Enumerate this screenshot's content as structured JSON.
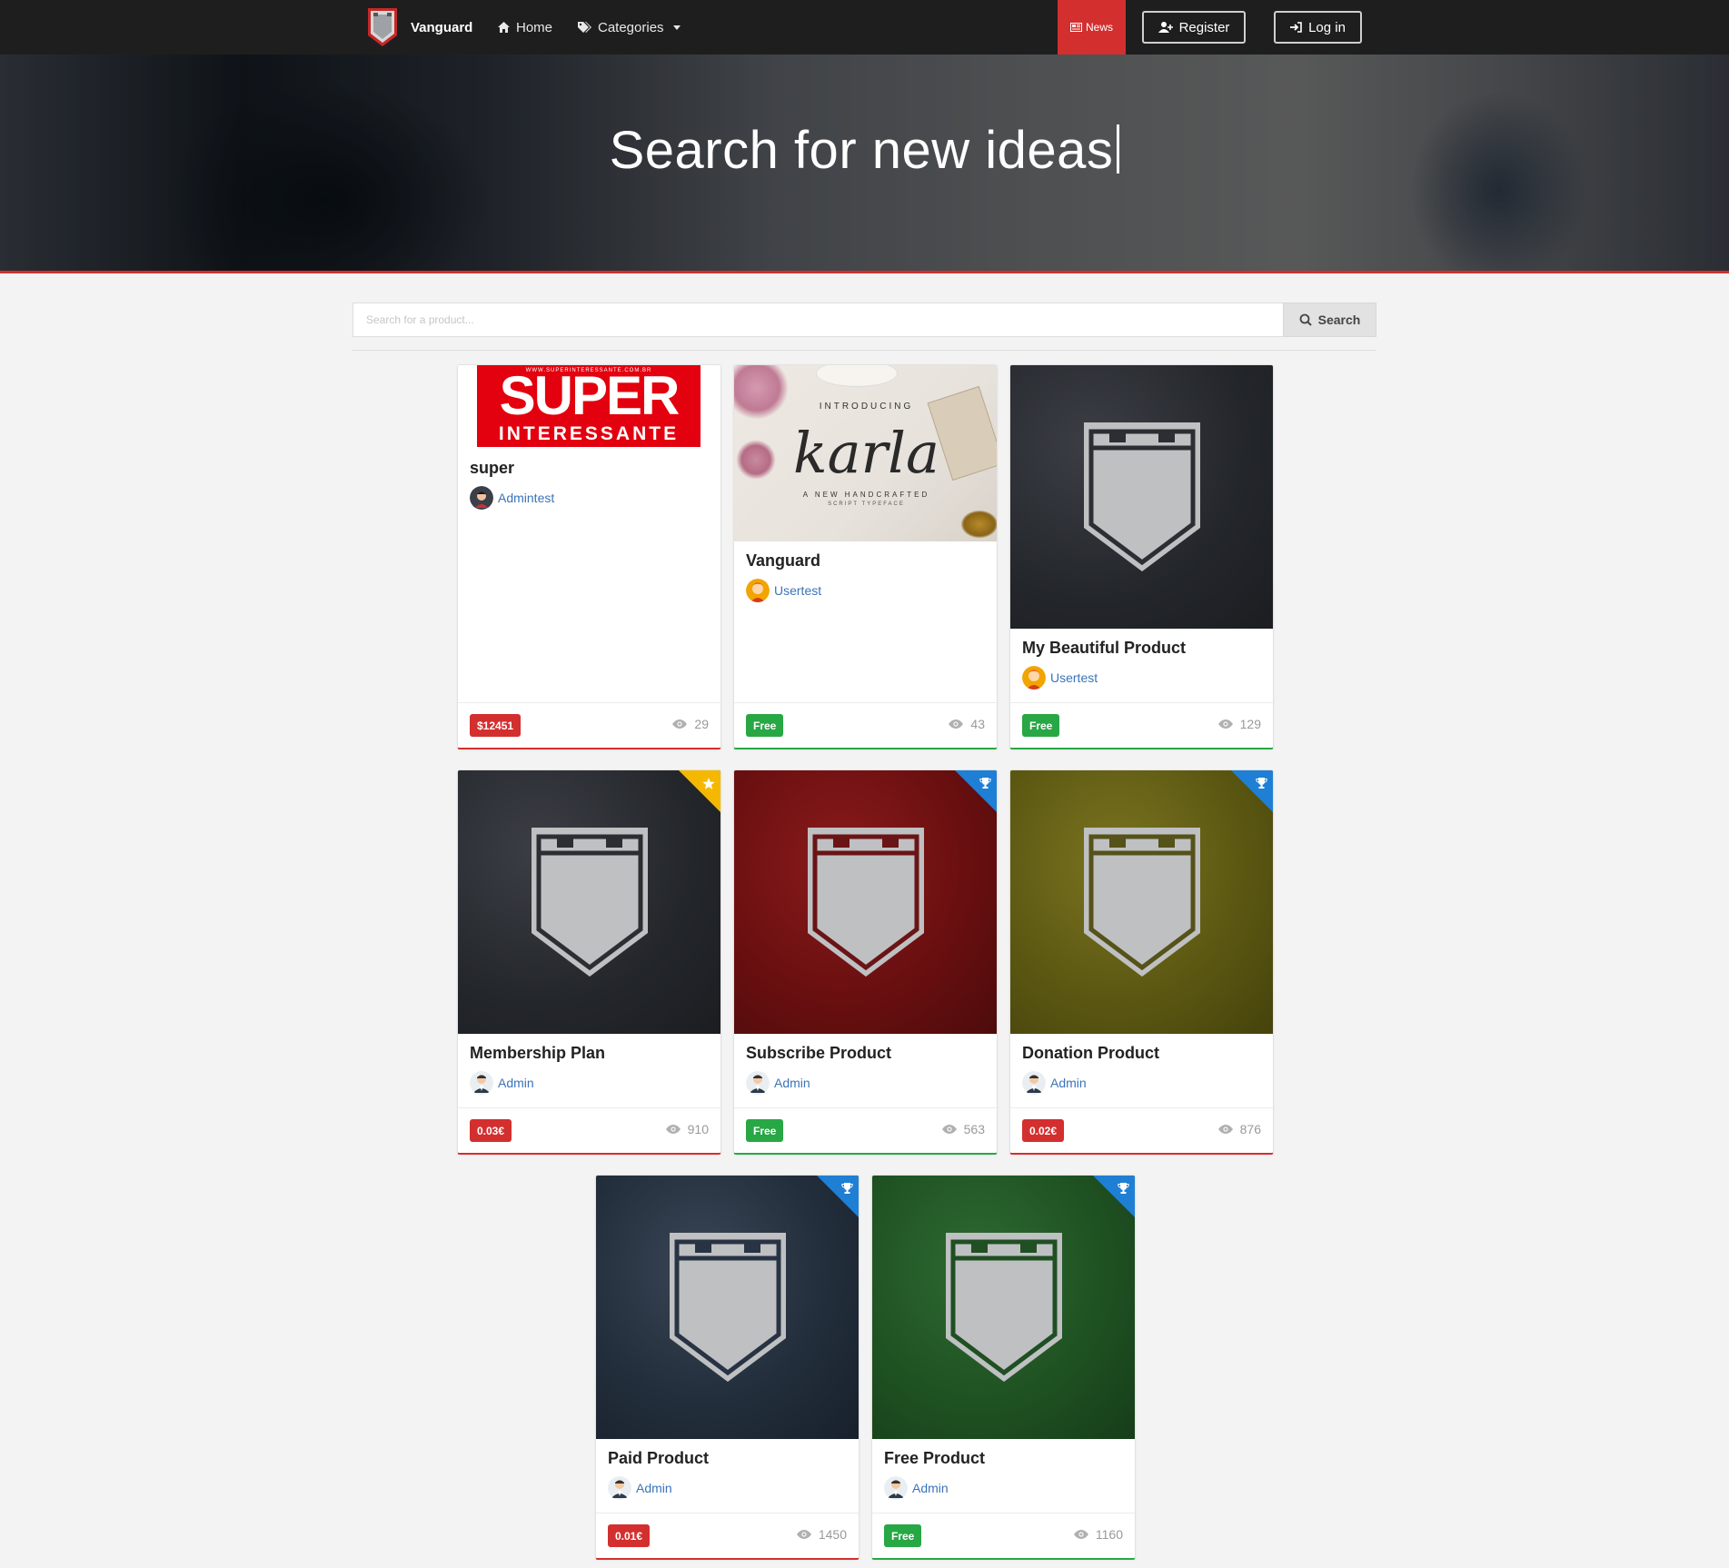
{
  "nav": {
    "brand": "Vanguard",
    "home": "Home",
    "categories": "Categories",
    "news": "News",
    "register": "Register",
    "login": "Log in"
  },
  "hero": {
    "title": "Search for new ideas"
  },
  "search": {
    "placeholder": "Search for a product...",
    "button": "Search"
  },
  "colors": {
    "accent": "#d32f2f",
    "free": "#28a745",
    "featured": "#f5b800",
    "premium": "#1f7fd4",
    "link": "#3a73b8"
  },
  "products": [
    {
      "title": "super",
      "author": "Admintest",
      "price": "$12451",
      "price_type": "paid",
      "views": "29",
      "image": "super-interessante-magazine-logo"
    },
    {
      "title": "Vanguard",
      "author": "Usertest",
      "price": "Free",
      "price_type": "free",
      "views": "43",
      "image": "karla-typeface-photo"
    },
    {
      "title": "My Beautiful Product",
      "author": "Usertest",
      "price": "Free",
      "price_type": "free",
      "views": "129",
      "image": "shield-placeholder-dark"
    },
    {
      "title": "Membership Plan",
      "author": "Admin",
      "price": "0.03€",
      "price_type": "paid",
      "views": "910",
      "image": "shield-placeholder-dark",
      "ribbon": "star-icon"
    },
    {
      "title": "Subscribe Product",
      "author": "Admin",
      "price": "Free",
      "price_type": "free",
      "views": "563",
      "image": "shield-placeholder-red",
      "ribbon": "trophy-icon"
    },
    {
      "title": "Donation Product",
      "author": "Admin",
      "price": "0.02€",
      "price_type": "paid",
      "views": "876",
      "image": "shield-placeholder-olive",
      "ribbon": "trophy-icon"
    },
    {
      "title": "Paid Product",
      "author": "Admin",
      "price": "0.01€",
      "price_type": "paid",
      "views": "1450",
      "image": "shield-placeholder-navy",
      "ribbon": "trophy-icon"
    },
    {
      "title": "Free Product",
      "author": "Admin",
      "price": "Free",
      "price_type": "free",
      "views": "1160",
      "image": "shield-placeholder-green",
      "ribbon": "trophy-icon"
    }
  ]
}
